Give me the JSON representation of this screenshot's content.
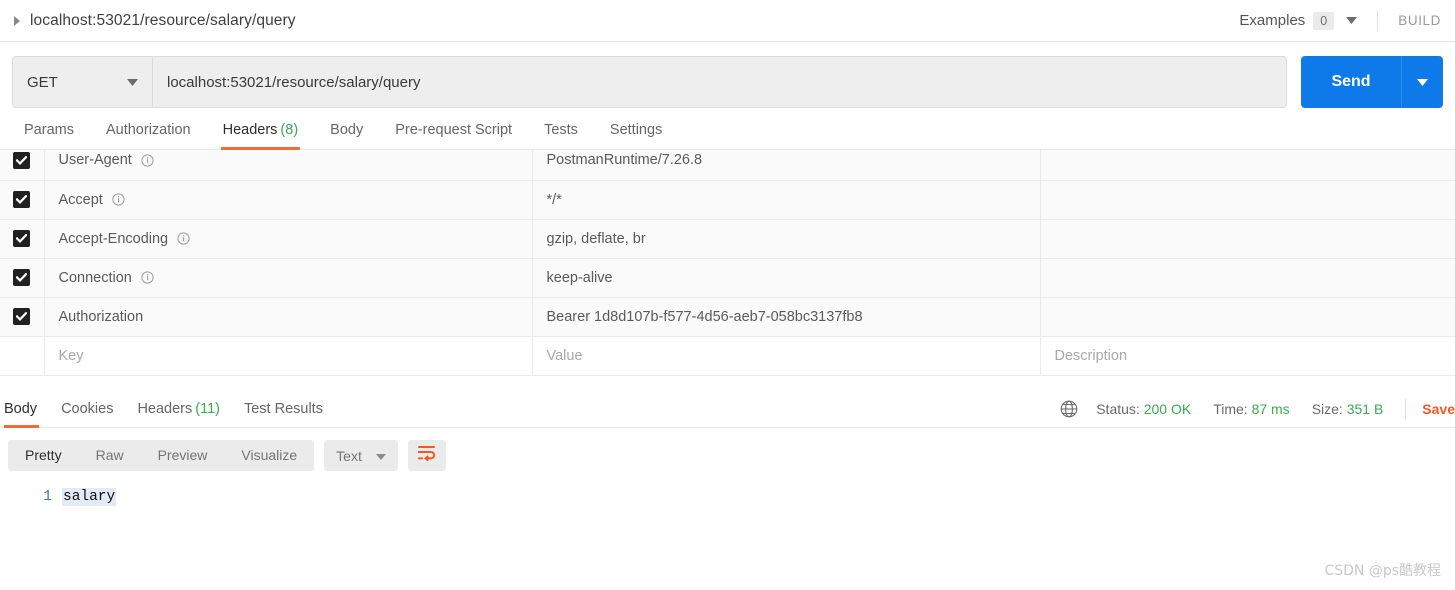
{
  "titlebar": {
    "request_name": "localhost:53021/resource/salary/query",
    "examples_label": "Examples",
    "examples_count": "0",
    "build_label": "BUILD"
  },
  "urlbar": {
    "method": "GET",
    "url": "localhost:53021/resource/salary/query",
    "send_label": "Send"
  },
  "request_tabs": [
    {
      "label": "Params",
      "count": "",
      "active": false
    },
    {
      "label": "Authorization",
      "count": "",
      "active": false
    },
    {
      "label": "Headers",
      "count": "(8)",
      "active": true
    },
    {
      "label": "Body",
      "count": "",
      "active": false
    },
    {
      "label": "Pre-request Script",
      "count": "",
      "active": false
    },
    {
      "label": "Tests",
      "count": "",
      "active": false
    },
    {
      "label": "Settings",
      "count": "",
      "active": false
    }
  ],
  "headers_table": {
    "columns": [
      "Key",
      "Value",
      "Description"
    ],
    "rows": [
      {
        "checked": true,
        "key": "User-Agent",
        "value": "PostmanRuntime/7.26.8",
        "description": "",
        "info": true
      },
      {
        "checked": true,
        "key": "Accept",
        "value": "*/*",
        "description": "",
        "info": true
      },
      {
        "checked": true,
        "key": "Accept-Encoding",
        "value": "gzip, deflate, br",
        "description": "",
        "info": true
      },
      {
        "checked": true,
        "key": "Connection",
        "value": "keep-alive",
        "description": "",
        "info": true
      },
      {
        "checked": true,
        "key": "Authorization",
        "value": "Bearer 1d8d107b-f577-4d56-aeb7-058bc3137fb8",
        "description": "",
        "info": false
      }
    ],
    "placeholder_row": {
      "key": "Key",
      "value": "Value",
      "description": "Description"
    }
  },
  "response": {
    "tabs": [
      {
        "label": "Body",
        "count": "",
        "active": true
      },
      {
        "label": "Cookies",
        "count": "",
        "active": false
      },
      {
        "label": "Headers",
        "count": "(11)",
        "active": false
      },
      {
        "label": "Test Results",
        "count": "",
        "active": false
      }
    ],
    "status_label": "Status:",
    "status_value": "200 OK",
    "time_label": "Time:",
    "time_value": "87 ms",
    "size_label": "Size:",
    "size_value": "351 B",
    "save_label": "Save"
  },
  "body_toolbar": {
    "view_modes": [
      {
        "label": "Pretty",
        "active": true
      },
      {
        "label": "Raw",
        "active": false
      },
      {
        "label": "Preview",
        "active": false
      },
      {
        "label": "Visualize",
        "active": false
      }
    ],
    "format": "Text"
  },
  "body_content": {
    "lines": [
      {
        "number": "1",
        "text": "salary"
      }
    ]
  },
  "watermark": "CSDN @ps酷教程",
  "colors": {
    "accent_orange": "#ef6c34",
    "send_blue": "#0e7aea",
    "status_green": "#3aab51",
    "save_orange": "#ef5b25"
  }
}
